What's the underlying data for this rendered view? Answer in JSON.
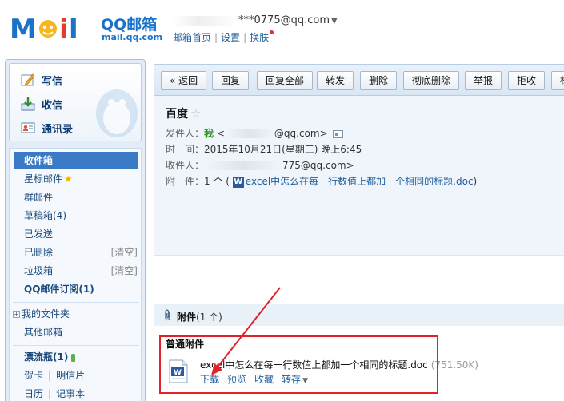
{
  "header": {
    "brand": "QQ邮箱",
    "brand_url": "mail.qq.com",
    "account_email": "***0775@qq.com",
    "links": [
      "邮箱首页",
      "设置",
      "换肤"
    ],
    "separator": "|",
    "skin_dot_color": "#e6312a"
  },
  "sidebar": {
    "quick": [
      {
        "label": "写信",
        "icon": "pencil-icon"
      },
      {
        "label": "收信",
        "icon": "inbox-arrow-icon"
      },
      {
        "label": "通讯录",
        "icon": "contact-card-icon"
      }
    ],
    "folders": {
      "inbox": "收件箱",
      "starred": "星标邮件",
      "group": "群邮件",
      "drafts": "草稿箱(4)",
      "sent": "已发送",
      "deleted": "已删除",
      "deleted_clear": "[清空]",
      "spam": "垃圾箱",
      "spam_clear": "[清空]",
      "subscriptions": "QQ邮件订阅(1)",
      "my_folders": "我的文件夹",
      "other": "其他邮箱",
      "bottle": "漂流瓶(1)",
      "greeting_card": "贺卡",
      "postcard": "明信片",
      "calendar": "日历",
      "notebook": "记事本",
      "pipe": "|"
    },
    "active_color": "#3a79c4"
  },
  "toolbar": {
    "buttons": [
      "« 返回",
      "回复",
      "回复全部",
      "转发",
      "删除",
      "彻底删除",
      "举报",
      "拒收",
      "标"
    ]
  },
  "mail": {
    "subject": "百度",
    "from_label": "发件人：",
    "from_name": "我",
    "from_email": "@qq.com>",
    "time_label": "时　间：",
    "time_value": "2015年10月21日(星期三) 晚上6:45",
    "to_label": "收件人：",
    "to_email": "775@qq.com>",
    "attach_label": "附　件：",
    "attach_value": "1 个 (",
    "attach_file": "excel中怎么在每一行数值上都加一个相同的标题.doc",
    "attach_close": ")"
  },
  "attachments": {
    "title": "附件",
    "count": "(1 个)",
    "section": "普通附件",
    "file_name": "excel中怎么在每一行数值上都加一个相同的标题.doc",
    "file_size": "(751.50K)",
    "actions": [
      "下载",
      "预览",
      "收藏",
      "转存"
    ],
    "highlight_color": "#e0232a"
  }
}
